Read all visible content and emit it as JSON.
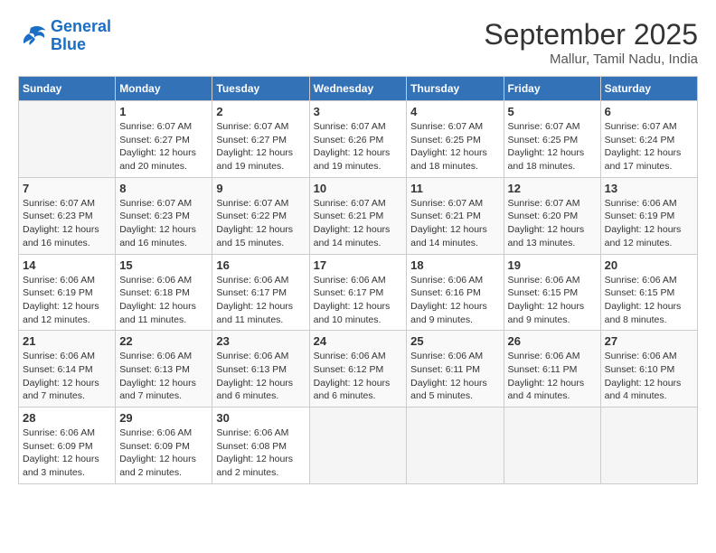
{
  "header": {
    "logo_line1": "General",
    "logo_line2": "Blue",
    "month": "September 2025",
    "location": "Mallur, Tamil Nadu, India"
  },
  "days_of_week": [
    "Sunday",
    "Monday",
    "Tuesday",
    "Wednesday",
    "Thursday",
    "Friday",
    "Saturday"
  ],
  "weeks": [
    [
      {
        "day": "",
        "info": ""
      },
      {
        "day": "1",
        "info": "Sunrise: 6:07 AM\nSunset: 6:27 PM\nDaylight: 12 hours\nand 20 minutes."
      },
      {
        "day": "2",
        "info": "Sunrise: 6:07 AM\nSunset: 6:27 PM\nDaylight: 12 hours\nand 19 minutes."
      },
      {
        "day": "3",
        "info": "Sunrise: 6:07 AM\nSunset: 6:26 PM\nDaylight: 12 hours\nand 19 minutes."
      },
      {
        "day": "4",
        "info": "Sunrise: 6:07 AM\nSunset: 6:25 PM\nDaylight: 12 hours\nand 18 minutes."
      },
      {
        "day": "5",
        "info": "Sunrise: 6:07 AM\nSunset: 6:25 PM\nDaylight: 12 hours\nand 18 minutes."
      },
      {
        "day": "6",
        "info": "Sunrise: 6:07 AM\nSunset: 6:24 PM\nDaylight: 12 hours\nand 17 minutes."
      }
    ],
    [
      {
        "day": "7",
        "info": "Sunrise: 6:07 AM\nSunset: 6:23 PM\nDaylight: 12 hours\nand 16 minutes."
      },
      {
        "day": "8",
        "info": "Sunrise: 6:07 AM\nSunset: 6:23 PM\nDaylight: 12 hours\nand 16 minutes."
      },
      {
        "day": "9",
        "info": "Sunrise: 6:07 AM\nSunset: 6:22 PM\nDaylight: 12 hours\nand 15 minutes."
      },
      {
        "day": "10",
        "info": "Sunrise: 6:07 AM\nSunset: 6:21 PM\nDaylight: 12 hours\nand 14 minutes."
      },
      {
        "day": "11",
        "info": "Sunrise: 6:07 AM\nSunset: 6:21 PM\nDaylight: 12 hours\nand 14 minutes."
      },
      {
        "day": "12",
        "info": "Sunrise: 6:07 AM\nSunset: 6:20 PM\nDaylight: 12 hours\nand 13 minutes."
      },
      {
        "day": "13",
        "info": "Sunrise: 6:06 AM\nSunset: 6:19 PM\nDaylight: 12 hours\nand 12 minutes."
      }
    ],
    [
      {
        "day": "14",
        "info": "Sunrise: 6:06 AM\nSunset: 6:19 PM\nDaylight: 12 hours\nand 12 minutes."
      },
      {
        "day": "15",
        "info": "Sunrise: 6:06 AM\nSunset: 6:18 PM\nDaylight: 12 hours\nand 11 minutes."
      },
      {
        "day": "16",
        "info": "Sunrise: 6:06 AM\nSunset: 6:17 PM\nDaylight: 12 hours\nand 11 minutes."
      },
      {
        "day": "17",
        "info": "Sunrise: 6:06 AM\nSunset: 6:17 PM\nDaylight: 12 hours\nand 10 minutes."
      },
      {
        "day": "18",
        "info": "Sunrise: 6:06 AM\nSunset: 6:16 PM\nDaylight: 12 hours\nand 9 minutes."
      },
      {
        "day": "19",
        "info": "Sunrise: 6:06 AM\nSunset: 6:15 PM\nDaylight: 12 hours\nand 9 minutes."
      },
      {
        "day": "20",
        "info": "Sunrise: 6:06 AM\nSunset: 6:15 PM\nDaylight: 12 hours\nand 8 minutes."
      }
    ],
    [
      {
        "day": "21",
        "info": "Sunrise: 6:06 AM\nSunset: 6:14 PM\nDaylight: 12 hours\nand 7 minutes."
      },
      {
        "day": "22",
        "info": "Sunrise: 6:06 AM\nSunset: 6:13 PM\nDaylight: 12 hours\nand 7 minutes."
      },
      {
        "day": "23",
        "info": "Sunrise: 6:06 AM\nSunset: 6:13 PM\nDaylight: 12 hours\nand 6 minutes."
      },
      {
        "day": "24",
        "info": "Sunrise: 6:06 AM\nSunset: 6:12 PM\nDaylight: 12 hours\nand 6 minutes."
      },
      {
        "day": "25",
        "info": "Sunrise: 6:06 AM\nSunset: 6:11 PM\nDaylight: 12 hours\nand 5 minutes."
      },
      {
        "day": "26",
        "info": "Sunrise: 6:06 AM\nSunset: 6:11 PM\nDaylight: 12 hours\nand 4 minutes."
      },
      {
        "day": "27",
        "info": "Sunrise: 6:06 AM\nSunset: 6:10 PM\nDaylight: 12 hours\nand 4 minutes."
      }
    ],
    [
      {
        "day": "28",
        "info": "Sunrise: 6:06 AM\nSunset: 6:09 PM\nDaylight: 12 hours\nand 3 minutes."
      },
      {
        "day": "29",
        "info": "Sunrise: 6:06 AM\nSunset: 6:09 PM\nDaylight: 12 hours\nand 2 minutes."
      },
      {
        "day": "30",
        "info": "Sunrise: 6:06 AM\nSunset: 6:08 PM\nDaylight: 12 hours\nand 2 minutes."
      },
      {
        "day": "",
        "info": ""
      },
      {
        "day": "",
        "info": ""
      },
      {
        "day": "",
        "info": ""
      },
      {
        "day": "",
        "info": ""
      }
    ]
  ]
}
